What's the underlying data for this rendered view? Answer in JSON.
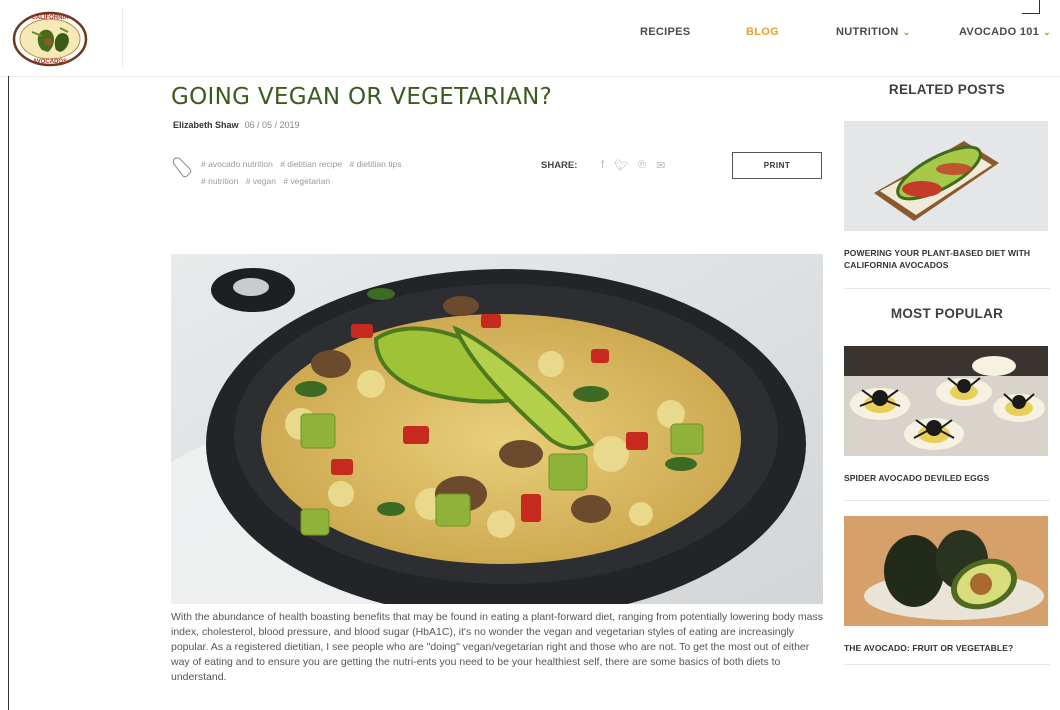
{
  "brand": {
    "logo_text_top": "CALIFORNIA",
    "logo_text_bottom": "AVOCADOS"
  },
  "nav": {
    "items": [
      {
        "label": "RECIPES",
        "active": false,
        "dropdown": false
      },
      {
        "label": "BLOG",
        "active": true,
        "dropdown": false
      },
      {
        "label": "NUTRITION",
        "active": false,
        "dropdown": true
      },
      {
        "label": "AVOCADO 101",
        "active": false,
        "dropdown": true
      }
    ],
    "caret": "⌄"
  },
  "colors": {
    "accent_orange": "#e9a02a",
    "title_green": "#3c5a1e",
    "caret_green": "#7ab13a"
  },
  "article": {
    "title": "GOING VEGAN OR VEGETARIAN?",
    "author": "Elizabeth Shaw",
    "date": "06 / 05 / 2019",
    "tags": [
      "# avocado nutrition",
      "# dietitian recipe",
      "# dietitian tips",
      "# nutrition",
      "# vegan",
      "# vegetarian"
    ],
    "share_label": "SHARE:",
    "share_icons": [
      "facebook-icon",
      "twitter-icon",
      "pinterest-icon",
      "email-icon"
    ],
    "print_label": "PRINT",
    "body": "With the abundance of health boasting benefits that may be found in eating a plant-forward diet, ranging from potentially lowering body mass index, cholesterol, blood pressure, and blood sugar (HbA1C), it's no wonder the vegan and vegetarian styles of eating are increasingly popular. As a registered dietitian, I see people who are \"doing\" vegan/vegetarian right and those who are not. To get the most out of either way of eating and to ensure you are getting the nutri-ents you need to be your healthiest self, there are some basics of both diets to understand."
  },
  "sidebar": {
    "related_heading": "RELATED POSTS",
    "related": [
      {
        "title": "POWERING YOUR PLANT-BASED DIET WITH CALIFORNIA AVOCADOS"
      }
    ],
    "popular_heading": "MOST POPULAR",
    "popular": [
      {
        "title": "SPIDER AVOCADO DEVILED EGGS"
      },
      {
        "title": "THE AVOCADO: FRUIT OR VEGETABLE?"
      }
    ]
  }
}
